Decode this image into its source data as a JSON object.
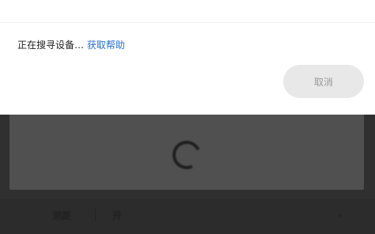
{
  "dialog": {
    "message": "正在搜寻设备…",
    "help_link": "获取帮助",
    "cancel_label": "取消"
  },
  "background": {
    "panel_title": "",
    "bottom_bar": {
      "left_tab": "测距",
      "mid_tab": "开",
      "caret": "›"
    }
  },
  "icons": {
    "loading": "spinner-icon"
  },
  "colors": {
    "link": "#2a6fd6",
    "overlay": "#2f2f2f",
    "button_bg": "#e8e8e8"
  }
}
